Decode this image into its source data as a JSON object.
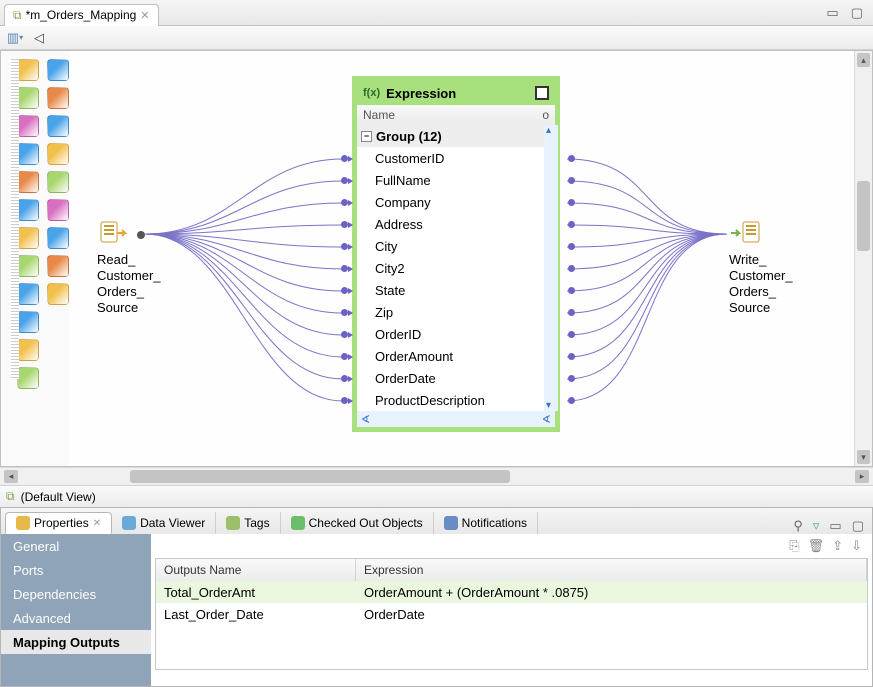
{
  "editor_tab": {
    "title": "*m_Orders_Mapping"
  },
  "default_view": {
    "label": "(Default View)"
  },
  "source_node": {
    "label_lines": [
      "Read_",
      "Customer_",
      "Orders_",
      "Source"
    ]
  },
  "target_node": {
    "label_lines": [
      "Write_",
      "Customer_",
      "Orders_",
      "Source"
    ]
  },
  "expression": {
    "title": "Expression",
    "name_header": "Name",
    "name_header_right": "o",
    "group_label": "Group (12)",
    "fields": [
      "CustomerID",
      "FullName",
      "Company",
      "Address",
      "City",
      "City2",
      "State",
      "Zip",
      "OrderID",
      "OrderAmount",
      "OrderDate",
      "ProductDescription"
    ]
  },
  "palette_icons": [
    [
      "#f2c04c",
      "#4aa3e8"
    ],
    [
      "#a8d66f",
      "#e8894a"
    ],
    [
      "#d96fc0",
      "#4aa3e8"
    ],
    [
      "#4aa3e8",
      "#f2c04c"
    ],
    [
      "#e8894a",
      "#a8d66f"
    ],
    [
      "#4aa3e8",
      "#d96fc0"
    ],
    [
      "#f2c04c",
      "#4aa3e8"
    ],
    [
      "#a8d66f",
      "#e8894a"
    ],
    [
      "#4aa3e8",
      "#f2c04c"
    ],
    [
      "#4aa3e8",
      ""
    ],
    [
      "#f2c04c",
      ""
    ],
    [
      "#a8d66f",
      ""
    ]
  ],
  "bottom_tabs": [
    {
      "label": "Properties",
      "active": true,
      "icon_color": "#e8b84a"
    },
    {
      "label": "Data Viewer",
      "active": false,
      "icon_color": "#6aaad9"
    },
    {
      "label": "Tags",
      "active": false,
      "icon_color": "#9dbf6b"
    },
    {
      "label": "Checked Out Objects",
      "active": false,
      "icon_color": "#6bbf6b"
    },
    {
      "label": "Notifications",
      "active": false,
      "icon_color": "#6a8cc5"
    }
  ],
  "vtabs": [
    {
      "label": "General",
      "active": false
    },
    {
      "label": "Ports",
      "active": false
    },
    {
      "label": "Dependencies",
      "active": false
    },
    {
      "label": "Advanced",
      "active": false
    },
    {
      "label": "Mapping Outputs",
      "active": true
    }
  ],
  "grid": {
    "headers": {
      "name": "Outputs Name",
      "expr": "Expression"
    },
    "rows": [
      {
        "name": "Total_OrderAmt",
        "expr": "OrderAmount + (OrderAmount * .0875)",
        "highlight": true
      },
      {
        "name": "Last_Order_Date",
        "expr": "OrderDate",
        "highlight": false
      }
    ]
  }
}
